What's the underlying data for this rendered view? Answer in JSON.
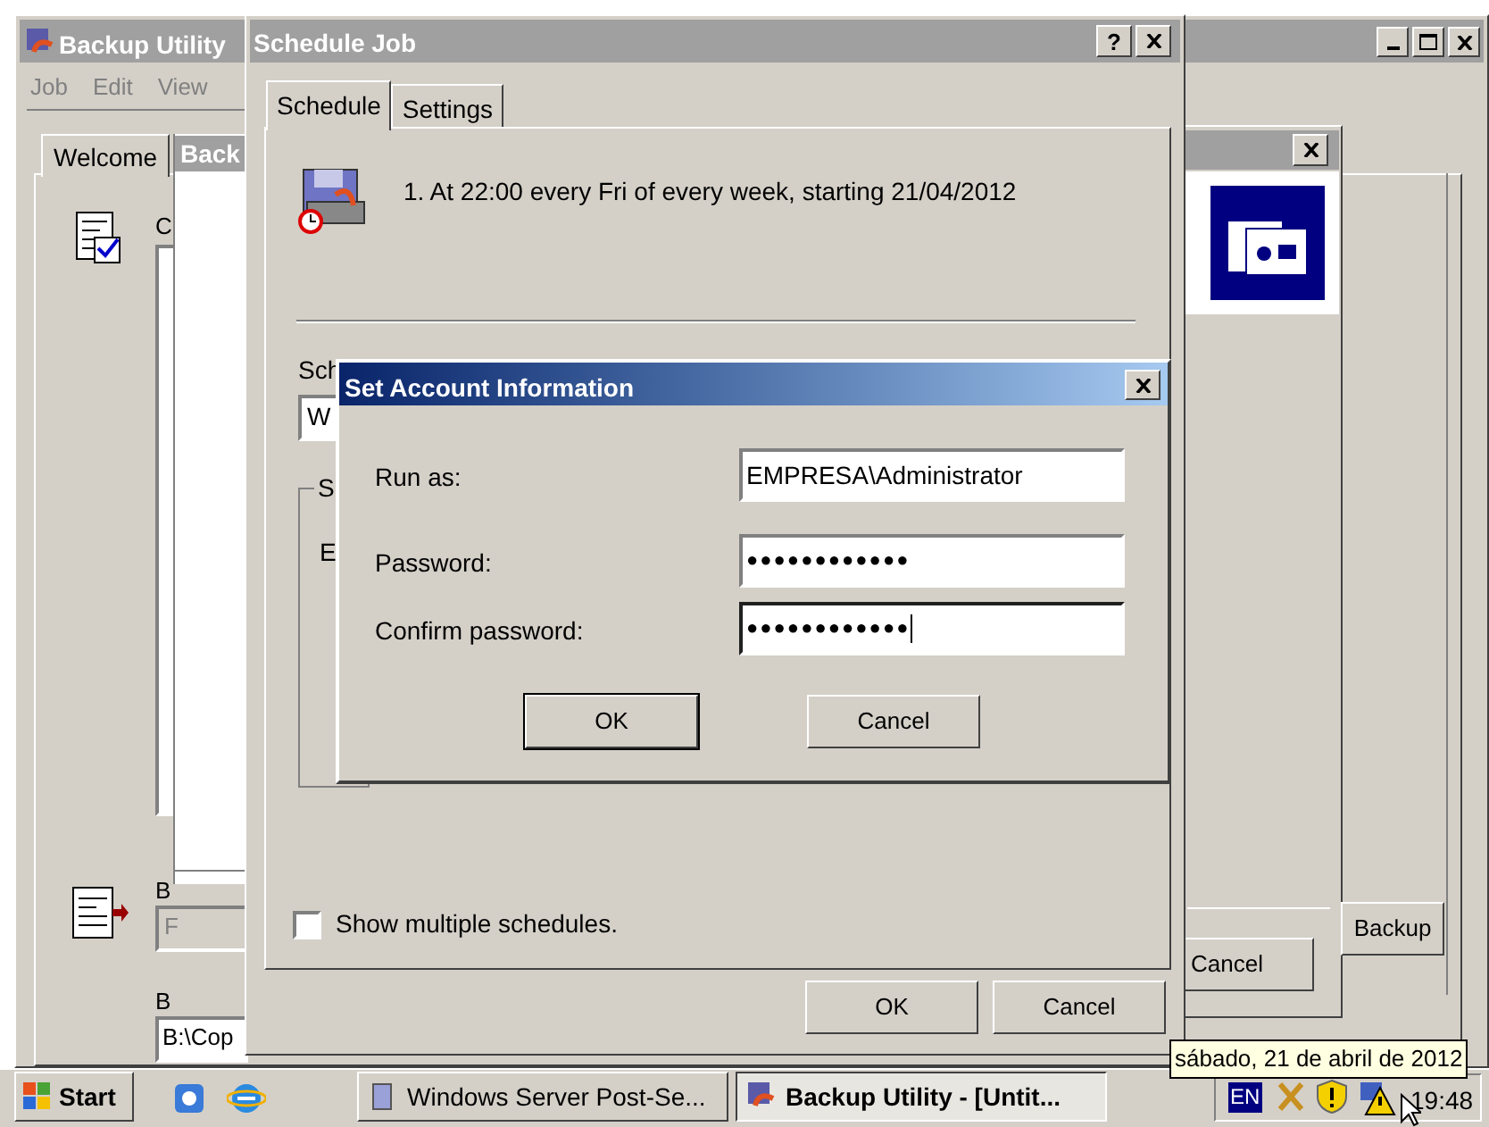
{
  "backup_utility": {
    "title": "Backup Utility",
    "menu": [
      "Job",
      "Edit",
      "View"
    ],
    "tabs": [
      {
        "label": "Welcome",
        "selected": true
      }
    ],
    "labels": [
      "C",
      "B",
      "B"
    ],
    "fields": [
      {
        "value": "F",
        "disabled": true
      },
      {
        "value": "B:\\Cop",
        "disabled": false
      }
    ],
    "inner_window": {
      "title": "Back"
    }
  },
  "background_dialog": {
    "buttons": [
      "Cancel",
      "Backup"
    ]
  },
  "schedule_job": {
    "title": "Schedule Job",
    "tabs": [
      {
        "label": "Schedule",
        "selected": true
      },
      {
        "label": "Settings",
        "selected": false
      }
    ],
    "schedule_text": "1. At 22:00 every Fri of every week, starting 21/04/2012",
    "help_button": "?",
    "label": "Sch",
    "field_value": "W",
    "group_label": "S",
    "group_text": "E",
    "checkbox": {
      "label": "Show multiple schedules.",
      "checked": false
    },
    "buttons": [
      "OK",
      "Cancel"
    ]
  },
  "account_dialog": {
    "title": "Set Account Information",
    "fields": [
      {
        "label": "Run as:",
        "value": "EMPRESA\\Administrator",
        "focused": false
      },
      {
        "label": "Password:",
        "value": "●●●●●●●●●●●●",
        "focused": false
      },
      {
        "label": "Confirm password:",
        "value": "●●●●●●●●●●●●",
        "focused": true
      }
    ],
    "buttons": [
      {
        "label": "OK",
        "default": true
      },
      {
        "label": "Cancel",
        "default": false
      }
    ]
  },
  "taskbar": {
    "start": "Start",
    "tasks": [
      {
        "label": "Windows Server Post-Se...",
        "selected": false
      },
      {
        "label": "Backup Utility - [Untit...",
        "selected": true
      }
    ],
    "language": "EN",
    "clock": "19:48",
    "tooltip": "sábado, 21 de abril de 2012"
  }
}
